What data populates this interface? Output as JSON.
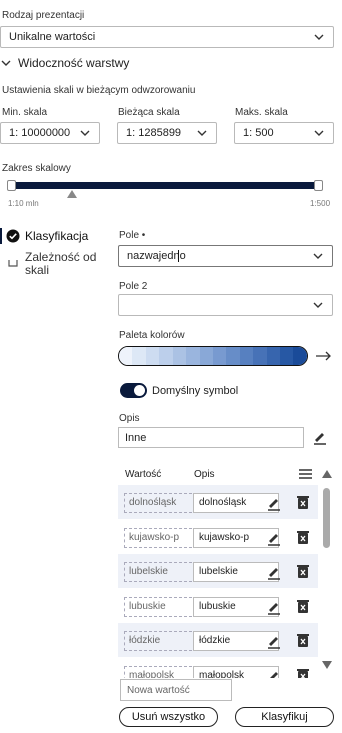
{
  "presentation": {
    "label": "Rodzaj prezentacji",
    "value": "Unikalne wartości"
  },
  "visibility": {
    "title": "Widoczność warstwy",
    "subtitle": "Ustawienia skali w bieżącym odwzorowaniu",
    "min": {
      "label": "Min. skala",
      "value": "1: 10000000"
    },
    "current": {
      "label": "Bieżąca skala",
      "value": "1: 1285899"
    },
    "max": {
      "label": "Maks. skala",
      "value": "1: 500"
    },
    "range_label": "Zakres skalowy",
    "range_min": "1:10 mln",
    "range_max": "1:500"
  },
  "nav": {
    "classification": "Klasyfikacja",
    "scale_dependency": "Zależność od skali"
  },
  "form": {
    "field_label": "Pole •",
    "field_value": "nazwajedno",
    "field2_label": "Pole 2",
    "field2_value": "",
    "palette_label": "Paleta kolorów",
    "palette_colors": [
      "#eef3fb",
      "#dde8f6",
      "#cddcf1",
      "#bccfeb",
      "#abc2e4",
      "#9ab5de",
      "#89a8d7",
      "#789ad0",
      "#678dc8",
      "#5780c0",
      "#4772b7",
      "#3765ae",
      "#2758a4",
      "#1a4b99"
    ],
    "default_symbol_label": "Domyślny symbol",
    "default_symbol_on": true,
    "opis_label": "Opis",
    "opis_value": "Inne"
  },
  "table": {
    "col_value": "Wartość",
    "col_opis": "Opis",
    "rows": [
      {
        "value": "dolnośląsk",
        "opis": "dolnośląsk"
      },
      {
        "value": "kujawsko-p",
        "opis": "kujawsko-p"
      },
      {
        "value": "lubelskie",
        "opis": "lubelskie"
      },
      {
        "value": "lubuskie",
        "opis": "lubuskie"
      },
      {
        "value": "łódzkie",
        "opis": "łódzkie"
      },
      {
        "value": "małopolsk",
        "opis": "małopolsk"
      }
    ]
  },
  "new_value_placeholder": "Nowa wartość",
  "buttons": {
    "remove_all": "Usuń wszystko",
    "classify": "Klasyfikuj"
  },
  "colors": {
    "accent": "#0a1a3c",
    "border": "#b9b9b9",
    "row_alt": "#eef1f8"
  }
}
